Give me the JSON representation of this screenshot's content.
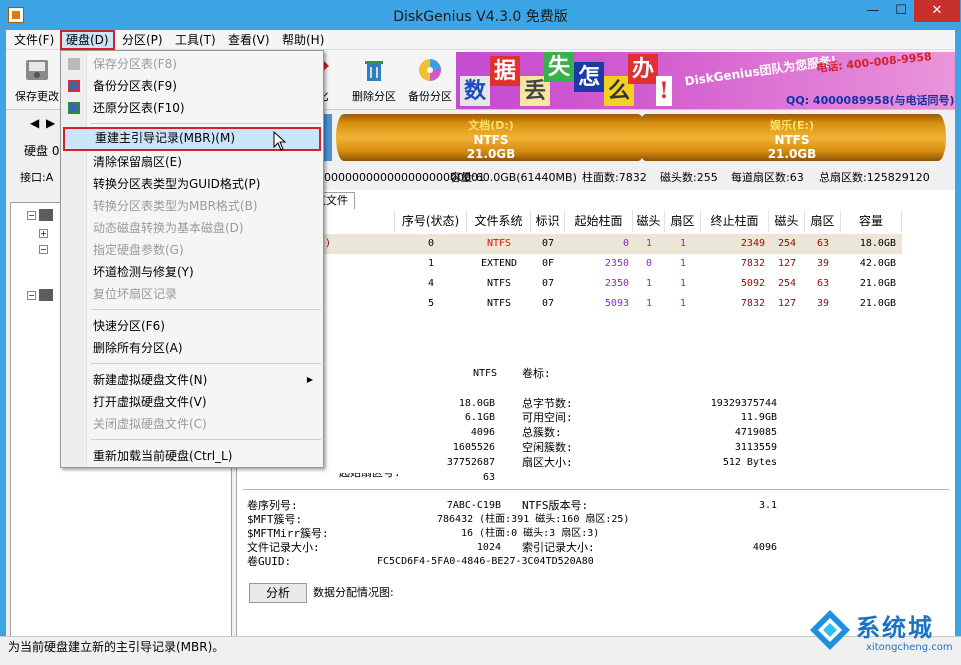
{
  "window": {
    "title": "DiskGenius V4.3.0 免费版",
    "min": "—",
    "max": "☐",
    "close": "✕"
  },
  "menubar": [
    "文件(F)",
    "硬盘(D)",
    "分区(P)",
    "工具(T)",
    "查看(V)",
    "帮助(H)"
  ],
  "toolbar": {
    "save": "保存更改",
    "quick": "化",
    "delete": "删除分区",
    "backup": "备份分区"
  },
  "banner": {
    "tiles": [
      "数",
      "据",
      "丢",
      "失",
      "怎",
      "么",
      "办",
      "!"
    ],
    "slogan": "DiskGenius团队为您服务!",
    "phone": "电话: 400-008-9958",
    "qq": "QQ: 4000089958(与电话同号)"
  },
  "disk_left": {
    "label_disk": "硬盘 0",
    "label_port": "接口:A"
  },
  "partitions_bar": [
    {
      "name": "文档(D:)",
      "fs": "NTFS",
      "size": "21.0GB"
    },
    {
      "name": "娱乐(E:)",
      "fs": "NTFS",
      "size": "21.0GB"
    }
  ],
  "infoline": {
    "serial": "00000000000000000000001",
    "capacity": "容量:60.0GB(61440MB)",
    "cylinders": "柱面数:7832",
    "heads": "磁头数:255",
    "sectors_per_track": "每道扇区数:63",
    "total_sectors": "总扇区数:125829120"
  },
  "tabs": {
    "files": "浏览文件"
  },
  "table": {
    "headers": [
      "序号(状态)",
      "文件系统",
      "标识",
      "起始柱面",
      "磁头",
      "扇区",
      "终止柱面",
      "磁头",
      "扇区",
      "容量"
    ],
    "rows": [
      {
        "label": "(C:)",
        "idx": "0",
        "fs": "NTFS",
        "id": "07",
        "sc": "0",
        "sh": "1",
        "ss": "1",
        "ec": "2349",
        "eh": "254",
        "es": "63",
        "cap": "18.0GB"
      },
      {
        "label": "",
        "idx": "1",
        "fs": "EXTEND",
        "id": "0F",
        "sc": "2350",
        "sh": "0",
        "ss": "1",
        "ec": "7832",
        "eh": "127",
        "es": "39",
        "cap": "42.0GB"
      },
      {
        "label": "D:)",
        "idx": "4",
        "fs": "NTFS",
        "id": "07",
        "sc": "2350",
        "sh": "1",
        "ss": "1",
        "ec": "5092",
        "eh": "254",
        "es": "63",
        "cap": "21.0GB"
      },
      {
        "label": "E:)",
        "idx": "5",
        "fs": "NTFS",
        "id": "07",
        "sc": "5093",
        "sh": "1",
        "ss": "1",
        "ec": "7832",
        "eh": "127",
        "es": "39",
        "cap": "21.0GB"
      }
    ]
  },
  "details": {
    "fs_value": "NTFS",
    "volume_label": "卷标:",
    "left_values": [
      "18.0GB",
      "6.1GB",
      "4096",
      "1605526",
      "37752687",
      "63"
    ],
    "right_labels": [
      "总字节数:",
      "可用空间:",
      "总簇数:",
      "空闲簇数:",
      "扇区大小:"
    ],
    "right_values": [
      "19329375744",
      "11.9GB",
      "4719085",
      "3113559",
      "512 Bytes"
    ],
    "trunc_label": "起始扇区号:",
    "serial_label": "卷序列号:",
    "serial_value": "7ABC-C19B",
    "ntfs_ver_label": "NTFS版本号:",
    "ntfs_ver_value": "3.1",
    "mft_label": "$MFT簇号:",
    "mft_value": "786432 (柱面:391 磁头:160 扇区:25)",
    "mftmirr_label": "$MFTMirr簇号:",
    "mftmirr_value": "16 (柱面:0 磁头:3 扇区:3)",
    "frs_label": "文件记录大小:",
    "frs_value": "1024",
    "irs_label": "索引记录大小:",
    "irs_value": "4096",
    "guid_label": "卷GUID:",
    "guid_value": "FC5CD6F4-5FA0-4846-BE27-3C04TD520A80",
    "analyze_button": "分析",
    "chart_label": "数据分配情况图:"
  },
  "dropdown": [
    {
      "label": "保存分区表(F8)",
      "disabled": true
    },
    {
      "label": "备份分区表(F9)",
      "disabled": false
    },
    {
      "label": "还原分区表(F10)",
      "disabled": false
    },
    {
      "label": "重建主引导记录(MBR)(M)",
      "disabled": false
    },
    {
      "label": "清除保留扇区(E)",
      "disabled": false
    },
    {
      "label": "转换分区表类型为GUID格式(P)",
      "disabled": false
    },
    {
      "label": "转换分区表类型为MBR格式(B)",
      "disabled": true
    },
    {
      "label": "动态磁盘转换为基本磁盘(D)",
      "disabled": true
    },
    {
      "label": "指定硬盘参数(G)",
      "disabled": true
    },
    {
      "label": "坏道检测与修复(Y)",
      "disabled": false
    },
    {
      "label": "复位坏扇区记录",
      "disabled": true
    },
    {
      "label": "快速分区(F6)",
      "disabled": false
    },
    {
      "label": "删除所有分区(A)",
      "disabled": false
    },
    {
      "label": "新建虚拟硬盘文件(N)",
      "disabled": false
    },
    {
      "label": "打开虚拟硬盘文件(V)",
      "disabled": false
    },
    {
      "label": "关闭虚拟硬盘文件(C)",
      "disabled": true
    },
    {
      "label": "重新加载当前硬盘(Ctrl_L)",
      "disabled": false
    }
  ],
  "statusbar": "为当前硬盘建立新的主引导记录(MBR)。",
  "watermark": {
    "brand": "系统城",
    "url": "xitongcheng.com"
  },
  "colors": {
    "titlebar": "#3da4e6",
    "highlight": "#d0222a",
    "menu_hover": "#cce4f7",
    "partition": "#e0990f"
  }
}
